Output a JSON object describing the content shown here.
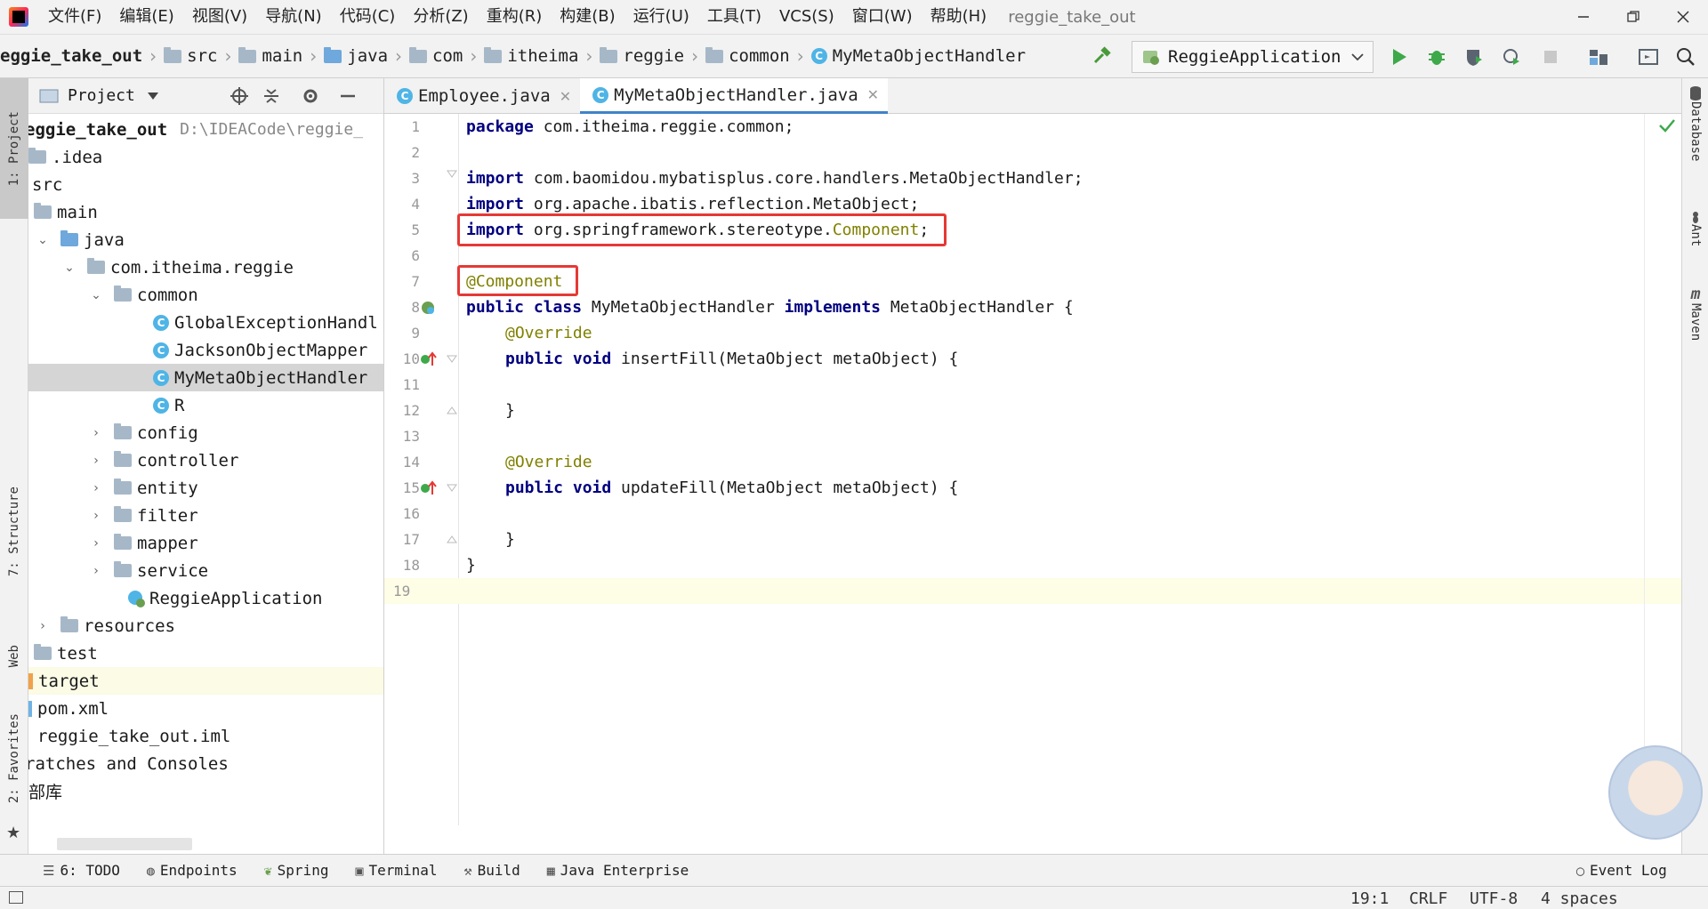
{
  "menubar": {
    "items": [
      "文件(F)",
      "编辑(E)",
      "视图(V)",
      "导航(N)",
      "代码(C)",
      "分析(Z)",
      "重构(R)",
      "构建(B)",
      "运行(U)",
      "工具(T)",
      "VCS(S)",
      "窗口(W)",
      "帮助(H)"
    ],
    "project_title": "reggie_take_out"
  },
  "navbar": {
    "crumbs": [
      "eggie_take_out",
      "src",
      "main",
      "java",
      "com",
      "itheima",
      "reggie",
      "common",
      "MyMetaObjectHandler"
    ],
    "run_config": "ReggieApplication"
  },
  "left_stripe": {
    "project": "1: Project",
    "structure": "7: Structure",
    "web": "Web",
    "favorites": "2: Favorites"
  },
  "project_panel": {
    "title": "Project",
    "root_name": "eggie_take_out",
    "root_path": "D:\\IDEACode\\reggie_",
    "items": [
      {
        "label": ".idea"
      },
      {
        "label": "src"
      },
      {
        "label": "main"
      },
      {
        "label": "java"
      },
      {
        "label": "com.itheima.reggie"
      },
      {
        "label": "common"
      },
      {
        "label": "GlobalExceptionHandl"
      },
      {
        "label": "JacksonObjectMapper"
      },
      {
        "label": "MyMetaObjectHandler"
      },
      {
        "label": "R"
      },
      {
        "label": "config"
      },
      {
        "label": "controller"
      },
      {
        "label": "entity"
      },
      {
        "label": "filter"
      },
      {
        "label": "mapper"
      },
      {
        "label": "service"
      },
      {
        "label": "ReggieApplication"
      },
      {
        "label": "resources"
      },
      {
        "label": "test"
      },
      {
        "label": "target"
      },
      {
        "label": "pom.xml"
      },
      {
        "label": "reggie_take_out.iml"
      },
      {
        "label": "ratches and Consoles"
      },
      {
        "label": "部库"
      }
    ]
  },
  "editor": {
    "tabs": [
      {
        "label": "Employee.java",
        "active": false
      },
      {
        "label": "MyMetaObjectHandler.java",
        "active": true
      }
    ],
    "line_numbers": [
      "1",
      "2",
      "3",
      "4",
      "5",
      "6",
      "7",
      "8",
      "9",
      "10",
      "11",
      "12",
      "13",
      "14",
      "15",
      "16",
      "17",
      "18",
      "19"
    ],
    "code": {
      "l1_kw": "package",
      "l1_rest": " com.itheima.reggie.common;",
      "l3_kw": "import",
      "l3_rest": " com.baomidou.mybatisplus.core.handlers.MetaObjectHandler;",
      "l4_kw": "import",
      "l4_rest": " org.apache.ibatis.reflection.MetaObject;",
      "l5_kw": "import",
      "l5_rest": " org.springframework.stereotype.",
      "l5_cls": "Component",
      "l5_end": ";",
      "l7_ann": "@Component",
      "l8_kw1": "public class",
      "l8_mid": " MyMetaObjectHandler ",
      "l8_kw2": "implements",
      "l8_end": " MetaObjectHandler {",
      "l9_ann": "@Override",
      "l10_kw": "public void",
      "l10_rest": " insertFill(MetaObject metaObject) {",
      "l12": "}",
      "l14_ann": "@Override",
      "l15_kw": "public void",
      "l15_rest": " updateFill(MetaObject metaObject) {",
      "l17": "}",
      "l18": "}"
    }
  },
  "right_stripe": {
    "database": "Database",
    "ant": "Ant",
    "maven": "Maven"
  },
  "bottom_tools": {
    "todo": "6: TODO",
    "endpoints": "Endpoints",
    "spring": "Spring",
    "terminal": "Terminal",
    "build": "Build",
    "java_enterprise": "Java Enterprise",
    "event_log": "Event Log"
  },
  "statusbar": {
    "position": "19:1",
    "line_sep": "CRLF",
    "encoding": "UTF-8",
    "indent": "4 spaces"
  },
  "colors": {
    "accent": "#4083c9",
    "highlight_box": "#e53935",
    "keyword": "#000080",
    "annotation": "#808000"
  }
}
